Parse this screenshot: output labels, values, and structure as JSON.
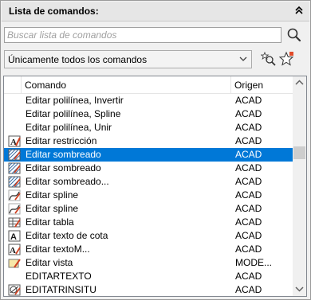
{
  "panel": {
    "title": "Lista de comandos:",
    "collapse_icon": "double-chevron-up-icon"
  },
  "search": {
    "placeholder": "Buscar lista de comandos",
    "value": "",
    "button_icon": "magnifier-icon"
  },
  "filter": {
    "selected": "Únicamente todos los comandos",
    "tools": [
      {
        "icon": "find-command-icon"
      },
      {
        "icon": "new-command-star-icon"
      }
    ]
  },
  "list": {
    "columns": {
      "command": "Comando",
      "origin": "Origen"
    },
    "rows": [
      {
        "name": "Editar polilínea, Invertir",
        "origin": "ACAD",
        "icon": "none"
      },
      {
        "name": "Editar polilínea, Spline",
        "origin": "ACAD",
        "icon": "none"
      },
      {
        "name": "Editar polilínea, Unir",
        "origin": "ACAD",
        "icon": "none"
      },
      {
        "name": "Editar restricción",
        "origin": "ACAD",
        "icon": "edit-constraint-icon"
      },
      {
        "name": "Editar sombreado",
        "origin": "ACAD",
        "icon": "edit-hatch-icon",
        "selected": true
      },
      {
        "name": "Editar sombreado",
        "origin": "ACAD",
        "icon": "edit-hatch-icon"
      },
      {
        "name": "Editar sombreado...",
        "origin": "ACAD",
        "icon": "edit-hatch-icon"
      },
      {
        "name": "Editar spline",
        "origin": "ACAD",
        "icon": "edit-spline-icon"
      },
      {
        "name": "Editar spline",
        "origin": "ACAD",
        "icon": "edit-spline-icon"
      },
      {
        "name": "Editar tabla",
        "origin": "ACAD",
        "icon": "edit-table-icon"
      },
      {
        "name": "Editar texto de cota",
        "origin": "ACAD",
        "icon": "edit-dimtext-icon"
      },
      {
        "name": "Editar textoM...",
        "origin": "ACAD",
        "icon": "edit-mtext-icon"
      },
      {
        "name": "Editar vista",
        "origin": "MODE...",
        "icon": "edit-view-icon"
      },
      {
        "name": "EDITARTEXTO",
        "origin": "ACAD",
        "icon": "none"
      },
      {
        "name": "EDITATRINSITU",
        "origin": "ACAD",
        "icon": "edit-attribute-icon"
      }
    ]
  },
  "scrollbar": {
    "up_icon": "scroll-up-arrow-icon",
    "down_icon": "scroll-down-arrow-icon"
  },
  "colors": {
    "selection": "#0078d7",
    "header_bg": "#e6e6e6",
    "panel_bg": "#f0f0f0"
  }
}
